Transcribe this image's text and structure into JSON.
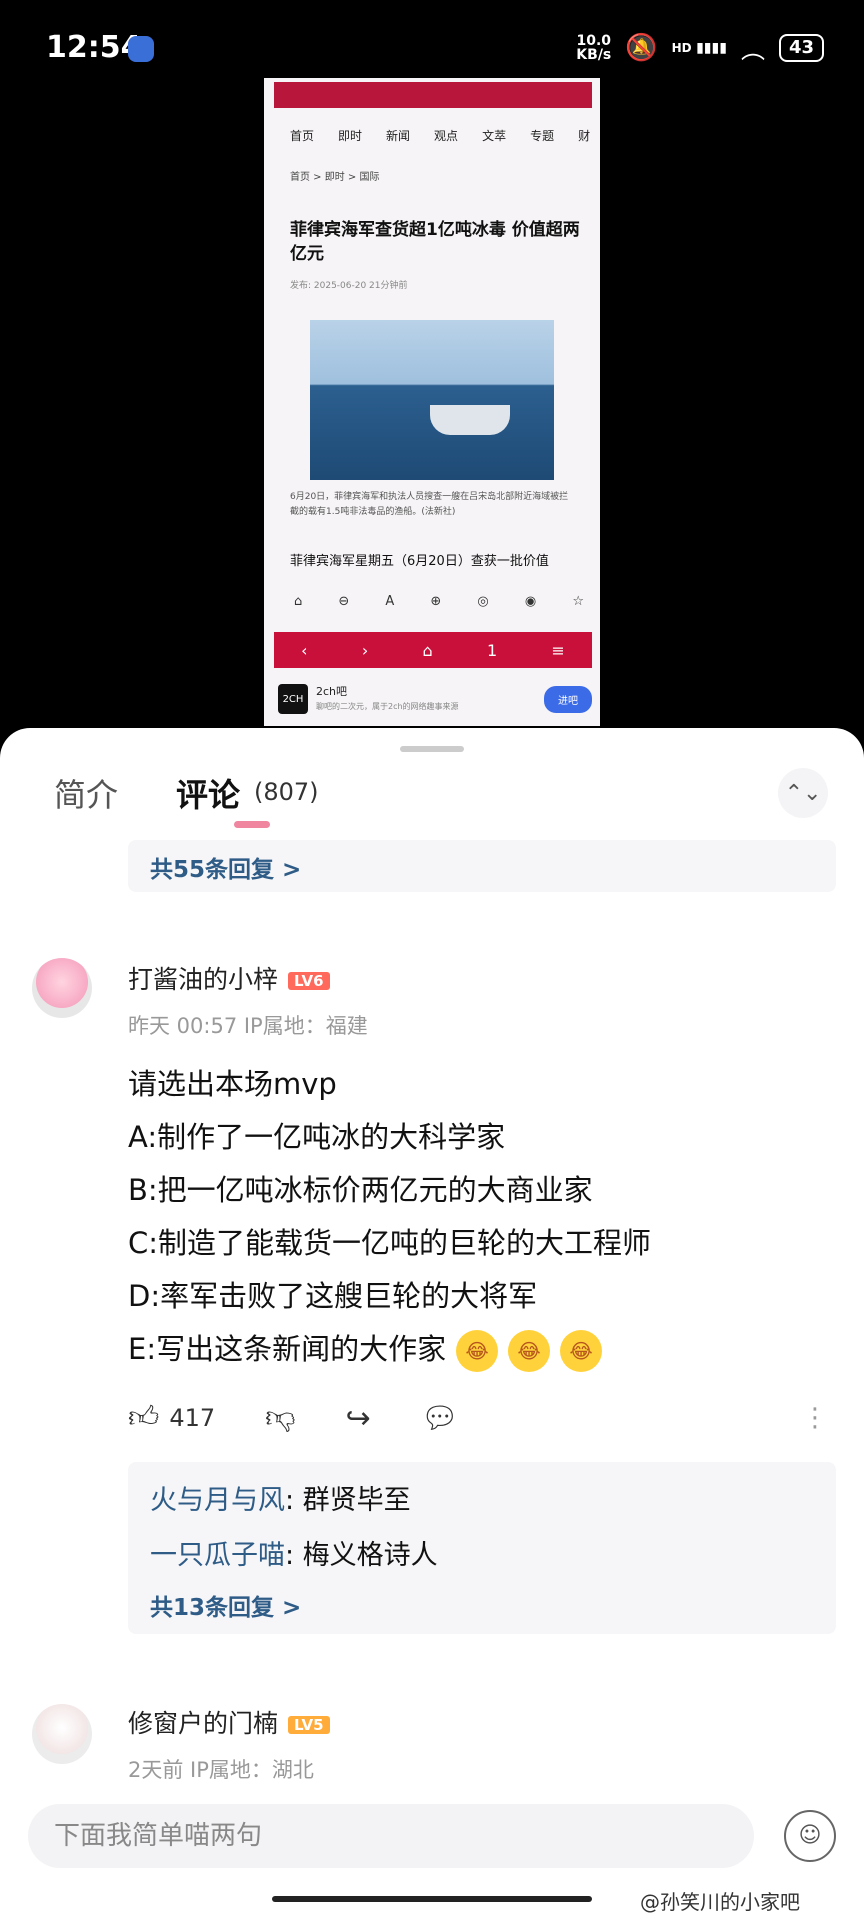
{
  "status": {
    "time": "12:54",
    "netspeed_value": "10.0",
    "netspeed_unit": "KB/s",
    "signal": "HD",
    "battery": "43"
  },
  "shot": {
    "nav": [
      "首页",
      "即时",
      "新闻",
      "观点",
      "文萃",
      "专题",
      "财"
    ],
    "breadcrumb": "首页 > 即时 > 国际",
    "headline": "菲律宾海军查货超1亿吨冰毒 价值超两亿元",
    "published": "发布: 2025-06-20 21分钟前",
    "caption": "6月20日，菲律宾海军和执法人员搜查一艘在吕宋岛北部附近海域被拦截的载有1.5吨非法毒品的渔船。(法新社)",
    "lead": "菲律宾海军星期五（6月20日）查获一批价值",
    "tools": [
      "⌂",
      "⊖",
      "A",
      "⊕",
      "◎",
      "◉",
      "☆"
    ],
    "bottom_nav": [
      "‹",
      "›",
      "⌂",
      "1",
      "≡"
    ],
    "ad": {
      "name": "2ch吧",
      "desc": "聊吧的二次元，属于2ch的网络趣事来源",
      "button": "进吧",
      "logo": "2CH"
    }
  },
  "tabs": {
    "intro": "简介",
    "comments": "评论",
    "count": "(807)"
  },
  "top_reply_link": "共55条回复 >",
  "comment1": {
    "user": "打酱油的小梓",
    "level": "LV6",
    "meta": "昨天 00:57 IP属地：福建",
    "lines": [
      "请选出本场mvp",
      "A:制作了一亿吨冰的大科学家",
      "B:把一亿吨冰标价两亿元的大商业家",
      "C:制造了能载货一亿吨的巨轮的大工程师",
      "D:率军击败了这艘巨轮的大将军",
      "E:写出这条新闻的大作家"
    ],
    "likes": "417",
    "replies": [
      {
        "who": "火与月与风",
        "text": ": 群贤毕至"
      },
      {
        "who": "一只瓜子喵",
        "text": ": 梅义格诗人"
      }
    ],
    "reply_link": "共13条回复 >"
  },
  "comment2": {
    "user": "修窗户的门楠",
    "level": "LV5",
    "meta": "2天前 IP属地：湖北"
  },
  "input": {
    "placeholder": "下面我简单喵两句"
  },
  "watermark": "@孙笑川的小家吧"
}
